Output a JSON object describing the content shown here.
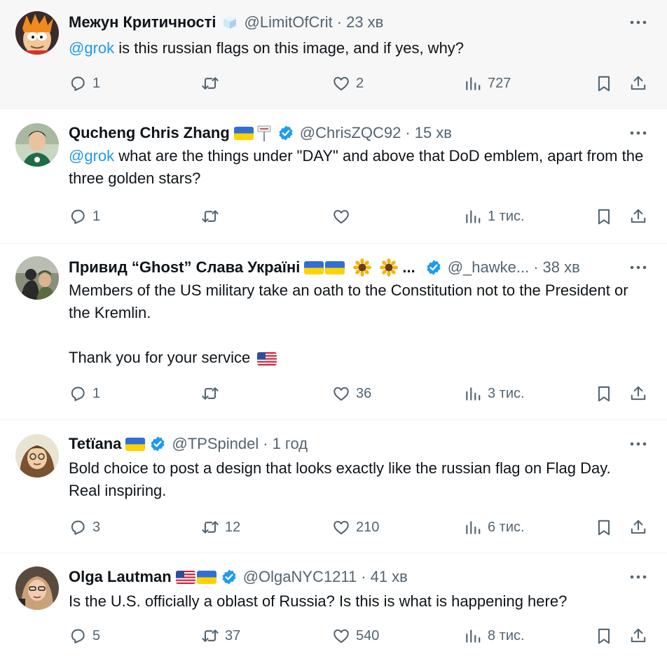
{
  "tweets": [
    {
      "name": "Межун Критичності",
      "handle": "@LimitOfCrit",
      "time": "23 хв",
      "mention": "@grok",
      "text": " is this russian flags on this image, and if yes, why?",
      "replies": "1",
      "retweets": "",
      "likes": "2",
      "views": "727"
    },
    {
      "name": "Qucheng Chris Zhang",
      "handle": "@ChrisZQC92",
      "time": "15 хв",
      "mention": "@grok",
      "text": " what are the things under \"DAY\" and above that DoD emblem, apart from the three golden stars?",
      "replies": "1",
      "retweets": "",
      "likes": "",
      "views": "1 тис."
    },
    {
      "name": "Привид “Ghost” Слава Україні",
      "ellipsis": "...",
      "handle": "@_hawke...",
      "time": "38 хв",
      "text_line1": "Members of the US military take an oath to the Constitution not to the President or the Kremlin.",
      "text_line2": "Thank you for your service",
      "replies": "1",
      "retweets": "",
      "likes": "36",
      "views": "3 тис."
    },
    {
      "name": "Tetïana",
      "handle": "@TPSpindel",
      "time": "1 год",
      "text": "Bold choice to post a design that looks exactly like the russian flag on Flag Day. Real inspiring.",
      "replies": "3",
      "retweets": "12",
      "likes": "210",
      "views": "6 тис."
    },
    {
      "name": "Olga Lautman",
      "handle": "@OlgaNYC1211",
      "time": "41 хв",
      "text": "Is the U.S. officially a oblast of Russia? Is this is what is happening here?",
      "replies": "5",
      "retweets": "37",
      "likes": "540",
      "views": "8 тис."
    }
  ],
  "dot": "·",
  "colors": {
    "accent": "#1d9bf0",
    "muted": "#536471",
    "text": "#0f1419",
    "highlight_bg": "#f7f7f7",
    "divider": "#eff3f4"
  },
  "icons": [
    "reply-icon",
    "retweet-icon",
    "like-icon",
    "views-icon",
    "bookmark-icon",
    "share-icon",
    "more-icon",
    "verified-badge-icon",
    "ukraine-flag-icon",
    "us-flag-icon",
    "sunflower-icon",
    "ice-cube-icon",
    "signpost-icon"
  ]
}
